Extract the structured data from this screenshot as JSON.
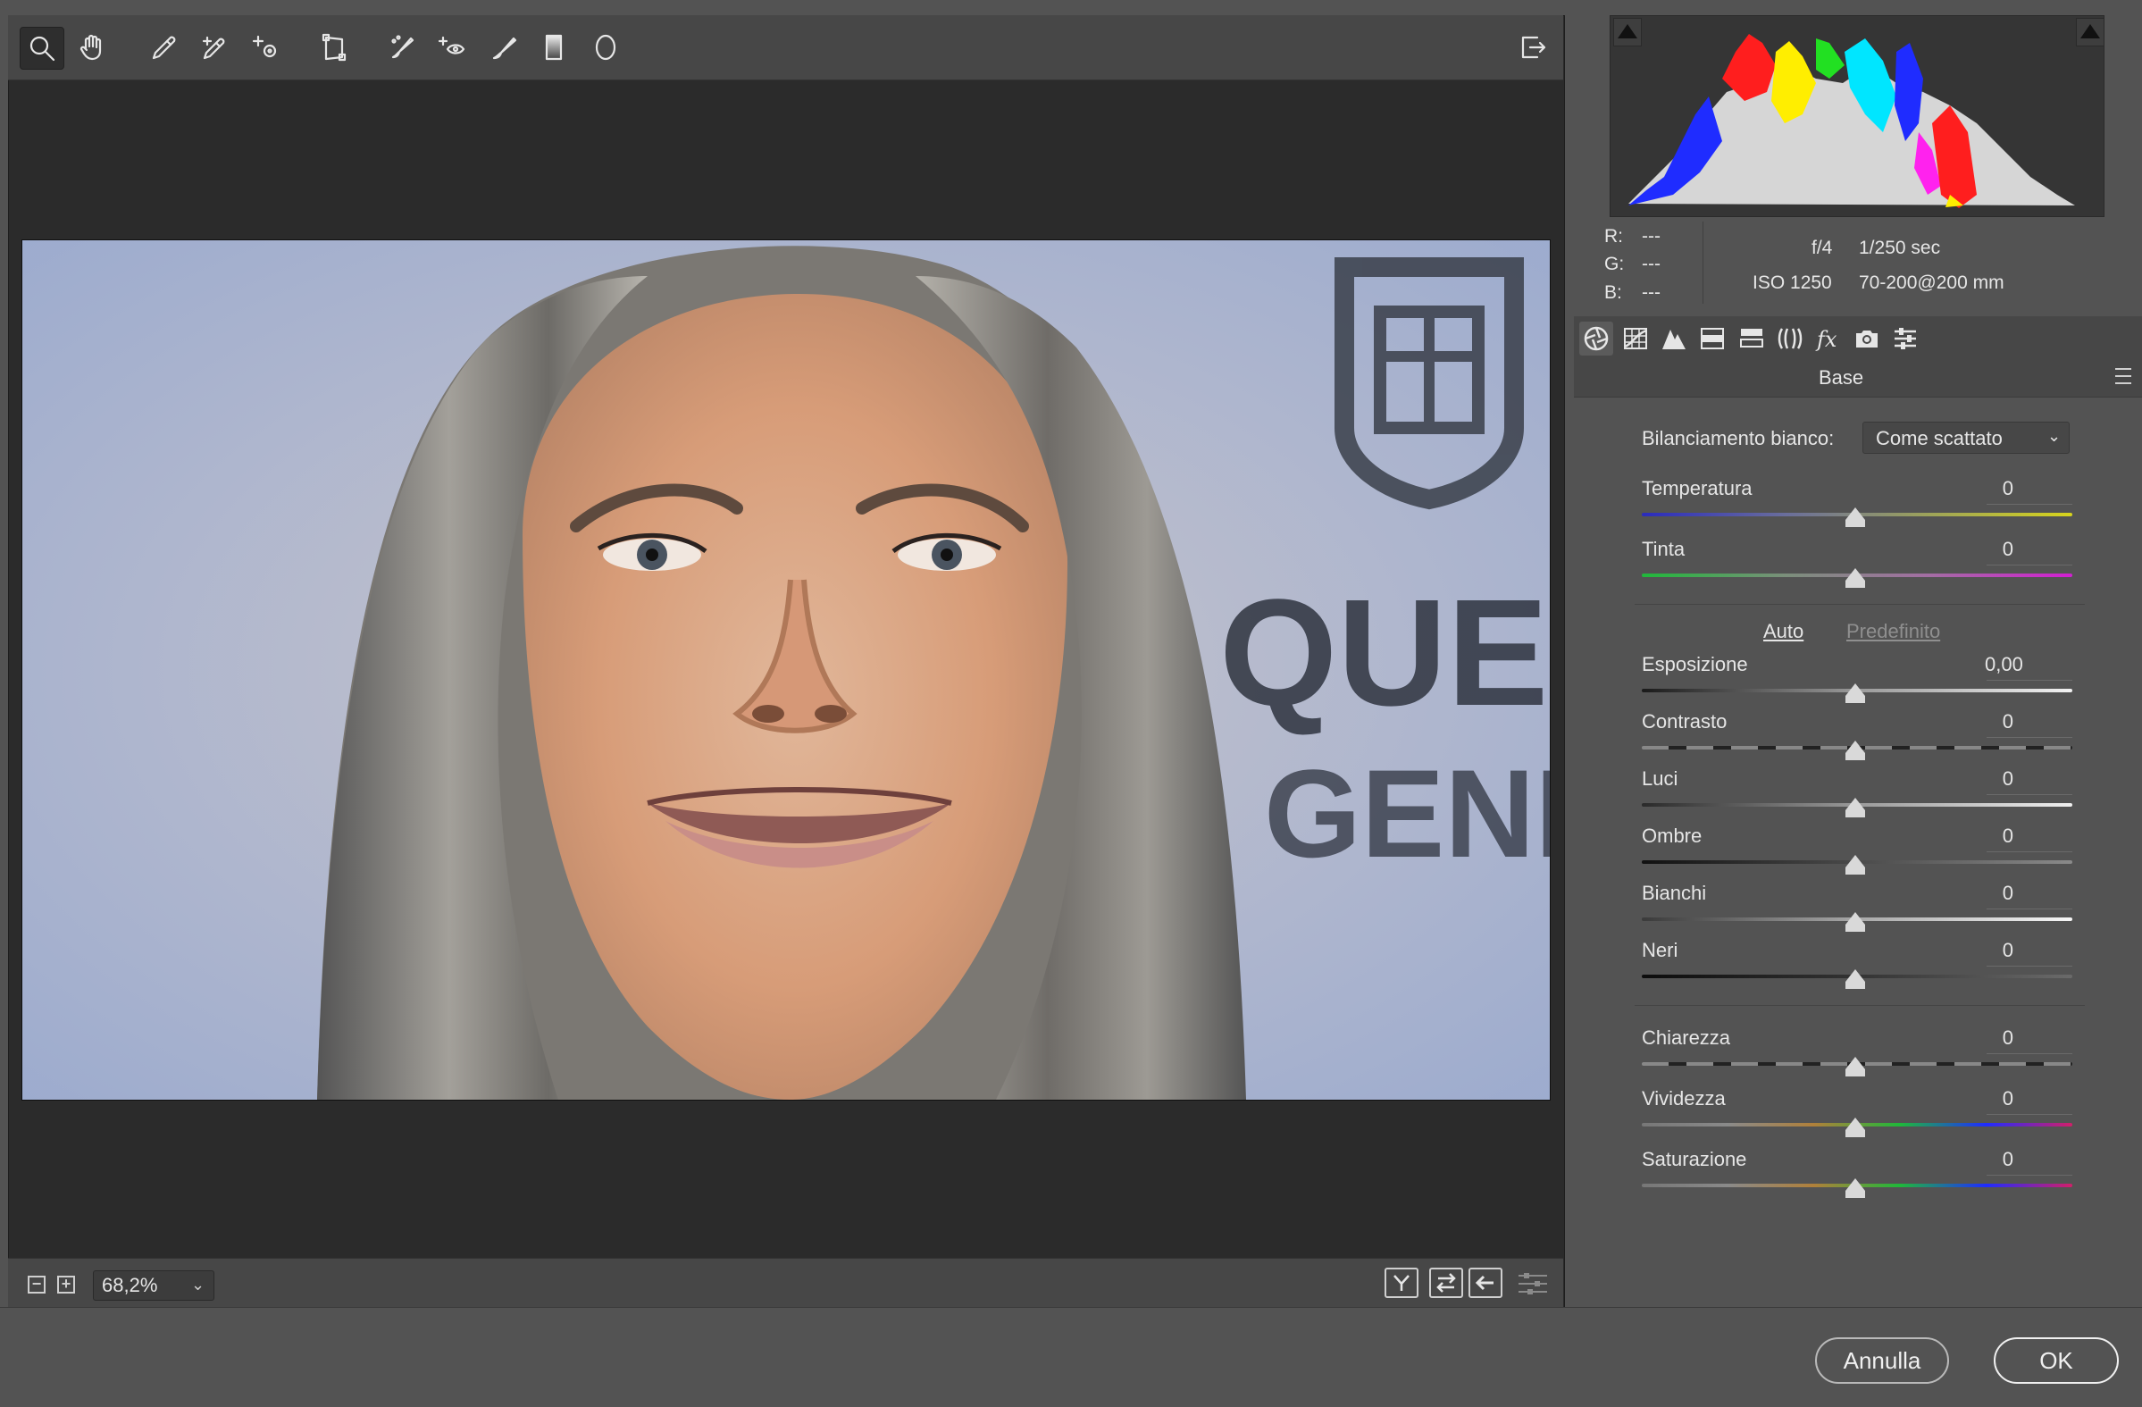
{
  "toolbar": {
    "tools": [
      {
        "name": "zoom-tool",
        "icon": "magnifier-icon",
        "active": true
      },
      {
        "name": "hand-tool",
        "icon": "hand-icon"
      },
      {
        "name": "white-balance-tool",
        "icon": "eyedropper-icon"
      },
      {
        "name": "color-sampler-tool",
        "icon": "eyedropper-plus-icon"
      },
      {
        "name": "targeted-adjustment-tool",
        "icon": "target-adjust-icon"
      },
      {
        "name": "transform-tool",
        "icon": "transform-icon"
      },
      {
        "name": "spot-removal-tool",
        "icon": "spot-brush-icon"
      },
      {
        "name": "red-eye-tool",
        "icon": "red-eye-icon"
      },
      {
        "name": "adjustment-brush-tool",
        "icon": "brush-icon"
      },
      {
        "name": "graduated-filter-tool",
        "icon": "gradient-icon"
      },
      {
        "name": "radial-filter-tool",
        "icon": "ellipse-icon"
      }
    ]
  },
  "status": {
    "zoom": "68,2%"
  },
  "histogram": {
    "colors": {
      "red": "#ff1e1e",
      "green": "#22e022",
      "blue": "#1f2cff",
      "yellow": "#ffee00",
      "cyan": "#00e6ff",
      "magenta": "#ff22ee",
      "gray": "#d6d6d6"
    }
  },
  "info": {
    "r_label": "R:",
    "r_value": "---",
    "g_label": "G:",
    "g_value": "---",
    "b_label": "B:",
    "b_value": "---",
    "aperture": "f/4",
    "shutter": "1/250 sec",
    "iso": "ISO 1250",
    "lens": "70-200@200 mm"
  },
  "panel": {
    "title": "Base",
    "white_balance_label": "Bilanciamento bianco:",
    "white_balance_value": "Come scattato",
    "auto_label": "Auto",
    "default_label": "Predefinito",
    "sliders": {
      "temperatura": {
        "label": "Temperatura",
        "value": "0"
      },
      "tinta": {
        "label": "Tinta",
        "value": "0"
      },
      "esposizione": {
        "label": "Esposizione",
        "value": "0,00"
      },
      "contrasto": {
        "label": "Contrasto",
        "value": "0"
      },
      "luci": {
        "label": "Luci",
        "value": "0"
      },
      "ombre": {
        "label": "Ombre",
        "value": "0"
      },
      "bianchi": {
        "label": "Bianchi",
        "value": "0"
      },
      "neri": {
        "label": "Neri",
        "value": "0"
      },
      "chiarezza": {
        "label": "Chiarezza",
        "value": "0"
      },
      "vividezza": {
        "label": "Vividezza",
        "value": "0"
      },
      "saturazione": {
        "label": "Saturazione",
        "value": "0"
      }
    }
  },
  "buttons": {
    "cancel": "Annulla",
    "ok": "OK"
  }
}
